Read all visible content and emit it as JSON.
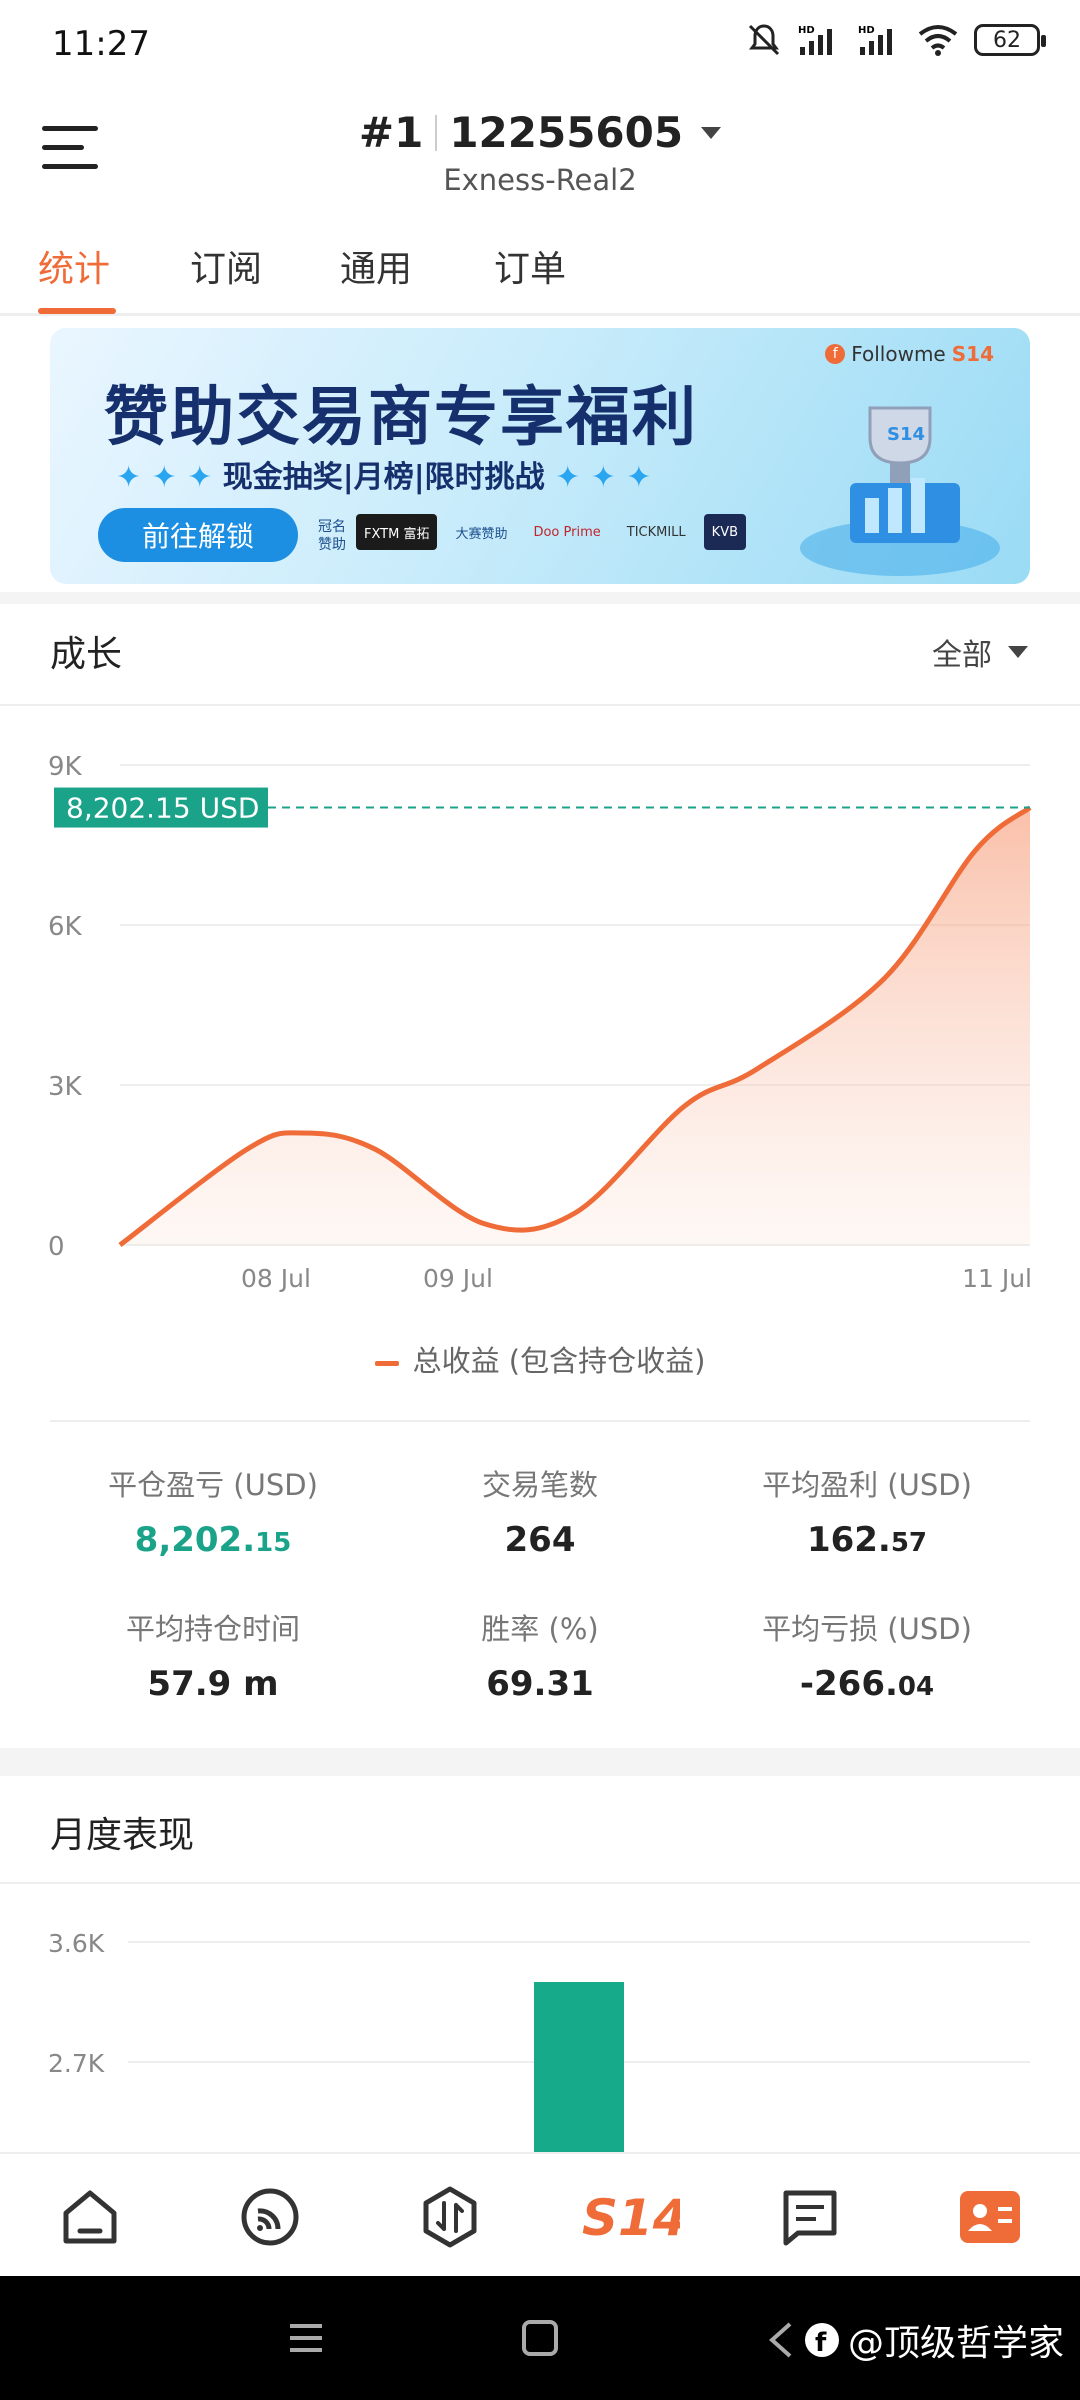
{
  "status": {
    "time": "11:27",
    "battery": "62"
  },
  "header": {
    "rank": "#1",
    "account_id": "12255605",
    "server": "Exness-Real2"
  },
  "tabs": [
    {
      "label": "统计",
      "active": true
    },
    {
      "label": "订阅",
      "active": false
    },
    {
      "label": "通用",
      "active": false
    },
    {
      "label": "订单",
      "active": false
    }
  ],
  "banner": {
    "brand": "Followme",
    "brand_tag": "S14",
    "title": "赞助交易商专享福利",
    "subtitle": "现金抽奖|月榜|限时挑战",
    "button": "前往解锁",
    "sponsor_label": "冠名赞助",
    "logos": [
      "FXTM 富拓",
      "大赛赞助",
      "Doo Prime",
      "TICKMILL",
      "KVB"
    ]
  },
  "growth": {
    "title": "成长",
    "filter": "全部",
    "current_label": "8,202.15 USD",
    "legend": "总收益 (包含持仓收益)"
  },
  "chart_data": [
    {
      "type": "area",
      "title": "成长",
      "y_ticks": [
        "0",
        "3K",
        "6K",
        "9K"
      ],
      "ylim": [
        0,
        9000
      ],
      "x_ticks": [
        "08 Jul",
        "09 Jul",
        "11 Jul"
      ],
      "series": [
        {
          "name": "总收益 (包含持仓收益)",
          "color": "#ef6c38",
          "points": [
            [
              0,
              0
            ],
            [
              0.7,
              1800
            ],
            [
              1.0,
              2100
            ],
            [
              1.4,
              1800
            ],
            [
              2.0,
              400
            ],
            [
              2.5,
              600
            ],
            [
              3.1,
              2600
            ],
            [
              3.5,
              3300
            ],
            [
              4.2,
              5000
            ],
            [
              4.7,
              7400
            ],
            [
              5.0,
              8202.15
            ]
          ]
        }
      ],
      "x_tick_positions": [
        1.0,
        2.0,
        5.0
      ],
      "reference_line": 8202.15,
      "grid": true
    },
    {
      "type": "bar",
      "title": "月度表现",
      "y_ticks": [
        "2.7K",
        "3.6K"
      ],
      "bars": [
        {
          "index": 1,
          "value": 3300,
          "color": "#16a98a"
        }
      ]
    }
  ],
  "stats": [
    {
      "label": "平仓盈亏 (USD)",
      "main": "8,202.",
      "dec": "15",
      "color": "green"
    },
    {
      "label": "交易笔数",
      "main": "264",
      "dec": "",
      "color": ""
    },
    {
      "label": "平均盈利 (USD)",
      "main": "162.",
      "dec": "57",
      "color": ""
    },
    {
      "label": "平均持仓时间",
      "main": "57.9 m",
      "dec": "",
      "color": ""
    },
    {
      "label": "胜率 (%)",
      "main": "69.31",
      "dec": "",
      "color": ""
    },
    {
      "label": "平均亏损 (USD)",
      "main": "-266.",
      "dec": "04",
      "color": ""
    }
  ],
  "monthly": {
    "title": "月度表现"
  },
  "bottom_nav": [
    "home-icon",
    "feed-icon",
    "trade-icon",
    "S14",
    "messages-icon",
    "profile-icon"
  ],
  "watermark": "@顶级哲学家",
  "colors": {
    "accent": "#ef6c38",
    "green": "#1aa389",
    "bar": "#16a98a"
  }
}
